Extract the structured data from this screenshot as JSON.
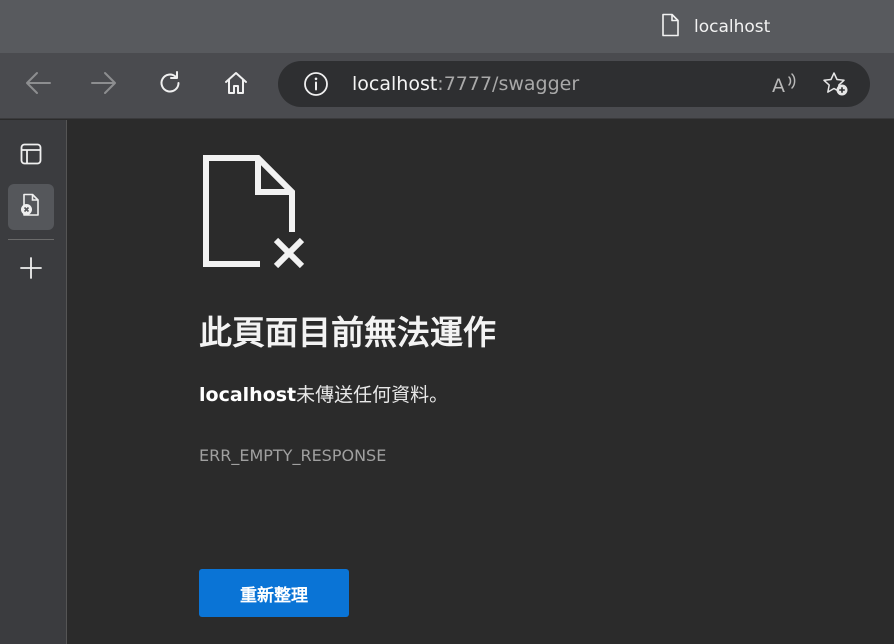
{
  "tab": {
    "title": "localhost",
    "icon": "page-icon"
  },
  "toolbar": {
    "back_icon": "back-arrow-icon",
    "forward_icon": "forward-arrow-icon",
    "refresh_icon": "refresh-icon",
    "home_icon": "home-icon"
  },
  "address": {
    "host": "localhost",
    "rest": ":7777/swagger",
    "info_icon": "info-icon",
    "read_aloud_icon": "read-aloud-icon",
    "favorite_icon": "add-favorite-icon"
  },
  "sidebar": {
    "items": [
      {
        "icon": "tab-actions-icon"
      },
      {
        "icon": "error-page-tab-icon"
      },
      {
        "icon": "new-tab-plus-icon"
      }
    ]
  },
  "error": {
    "icon": "broken-file-icon",
    "title": "此頁面目前無法運作",
    "host": "localhost",
    "message_suffix": "未傳送任何資料。",
    "code": "ERR_EMPTY_RESPONSE",
    "reload_label": "重新整理"
  },
  "colors": {
    "accent": "#0a74d6",
    "titlebar": "#585a5e",
    "toolbar": "#4a4b4f",
    "page_bg": "#2b2b2b"
  }
}
